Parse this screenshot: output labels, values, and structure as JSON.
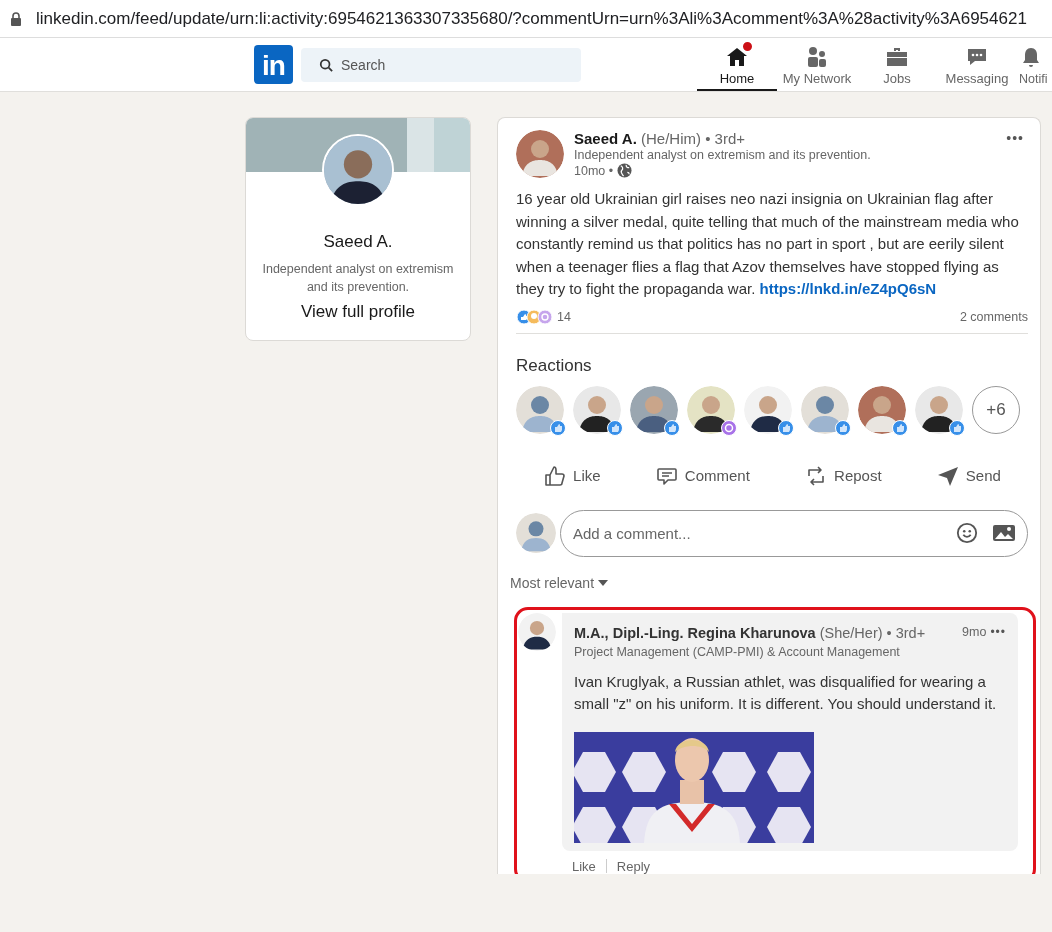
{
  "address_bar": {
    "url": "linkedin.com/feed/update/urn:li:activity:6954621363307335680/?commentUrn=urn%3Ali%3Acomment%3A%28activity%3A6954621"
  },
  "nav": {
    "logo": "in",
    "search": {
      "placeholder": "Search"
    },
    "items": [
      {
        "label": "Home",
        "selected": true,
        "badge": true,
        "kind": "home"
      },
      {
        "label": "My Network",
        "selected": false,
        "badge": false,
        "kind": "network"
      },
      {
        "label": "Jobs",
        "selected": false,
        "badge": false,
        "kind": "jobs"
      },
      {
        "label": "Messaging",
        "selected": false,
        "badge": false,
        "kind": "messaging"
      },
      {
        "label": "Notifi",
        "selected": false,
        "badge": false,
        "kind": "bell"
      }
    ]
  },
  "profile_card": {
    "name": "Saeed A.",
    "headline": "Independent analyst on extremism and its prevention.",
    "link": "View full profile"
  },
  "post": {
    "author": "Saeed A.",
    "pronouns": "(He/Him)",
    "degree": "• 3rd+",
    "headline": "Independent analyst on extremism and its prevention.",
    "time": "10mo •",
    "menu": "•••",
    "body": "16 year old Ukrainian girl raises neo nazi insignia on Ukrainian flag after winning a silver medal, quite telling that much of the mainstream media who constantly remind us that politics has no part in sport , but are eerily silent when a teenager flies a flag that Azov themselves have stopped flying as they try to fight the propaganda war.",
    "link": "https://lnkd.in/eZ4pQ6sN",
    "reaction_count": "14",
    "comments_count": "2 comments",
    "reactions_title": "Reactions",
    "reactors": [
      {
        "default_avatar": true,
        "kind": "like"
      },
      {
        "default_avatar": false,
        "kind": "like"
      },
      {
        "default_avatar": false,
        "kind": "like"
      },
      {
        "default_avatar": false,
        "kind": "curious"
      },
      {
        "default_avatar": false,
        "kind": "like"
      },
      {
        "default_avatar": true,
        "kind": "like"
      },
      {
        "default_avatar": false,
        "kind": "like"
      },
      {
        "default_avatar": false,
        "kind": "like"
      }
    ],
    "more_reactors": "+6",
    "actions": [
      {
        "label": "Like",
        "kind": "like"
      },
      {
        "label": "Comment",
        "kind": "comment"
      },
      {
        "label": "Repost",
        "kind": "repost"
      },
      {
        "label": "Send",
        "kind": "send"
      }
    ],
    "comment_box": {
      "placeholder": "Add a comment..."
    },
    "sort": "Most relevant",
    "comments": [
      {
        "author": "M.A., Dipl.-Ling. Regina Kharunova",
        "pronouns": "(She/Her)",
        "degree": "• 3rd+",
        "headline": "Project Management (CAMP-PMI) & Account Management",
        "time": "9mo",
        "menu": "•••",
        "body": "Ivan Kruglyak, a Russian athlet, was disqualified for wearing a small \"z\" on his uniform. It is different. You should understand it.",
        "highlighted": true,
        "actions": [
          "Like",
          "Reply"
        ]
      }
    ]
  }
}
